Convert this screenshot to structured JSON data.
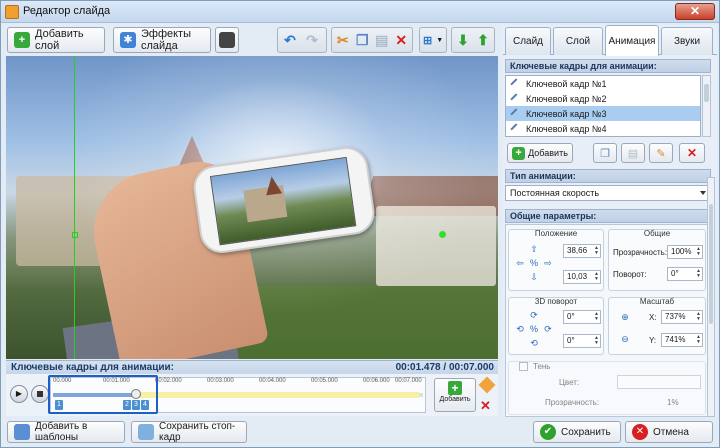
{
  "window": {
    "title": "Редактор слайда",
    "close_label": "✕"
  },
  "toolbar": {
    "add_layer": "Добавить слой",
    "effects": "Эффекты слайда"
  },
  "timeline": {
    "header_label": "Ключевые кадры для анимации:",
    "time": "00:01.478 / 00:07.000",
    "ticks": [
      "00.000",
      "00:01.000",
      "00:02.000",
      "00:03.000",
      "00:04.000",
      "00:05.000",
      "00:06.000",
      "00:07.000"
    ],
    "keyframes": [
      "1",
      "2",
      "3",
      "4"
    ],
    "add_label": "Добавить"
  },
  "bottom": {
    "add_template": "Добавить в шаблоны",
    "save_frame": "Сохранить стоп-кадр",
    "save": "Сохранить",
    "cancel": "Отмена"
  },
  "tabs": [
    "Слайд",
    "Слой",
    "Анимация",
    "Звуки"
  ],
  "panel": {
    "kf_header": "Ключевые кадры для анимации:",
    "kf_items": [
      "Ключевой кадр №1",
      "Ключевой кадр №2",
      "Ключевой кадр №3",
      "Ключевой кадр №4"
    ],
    "kf_selected": 2,
    "add_btn": "Добавить",
    "anim_type_header": "Тип анимации:",
    "anim_type_value": "Постоянная скорость",
    "params_header": "Общие параметры:",
    "position_title": "Положение",
    "pos_x": "38,66",
    "pos_y": "10,03",
    "general_title": "Общие",
    "opacity_label": "Прозрачность:",
    "opacity_value": "100%",
    "rotate_label": "Поворот:",
    "rotate_value": "0°",
    "rot3d_title": "3D поворот",
    "rot3d_1": "0°",
    "rot3d_2": "0°",
    "scale_title": "Масштаб",
    "scale_x_label": "X:",
    "scale_x": "737%",
    "scale_y_label": "Y:",
    "scale_y": "741%",
    "shadow_label": "Тень",
    "shadow_color_label": "Цвет:",
    "shadow_opacity_label": "Прозрачность:",
    "shadow_opacity_value": "1%"
  },
  "colors": {
    "accent": "#1d5fc7",
    "add_green": "#39a83a",
    "delete_red": "#d82020",
    "guide": "#23d023"
  }
}
